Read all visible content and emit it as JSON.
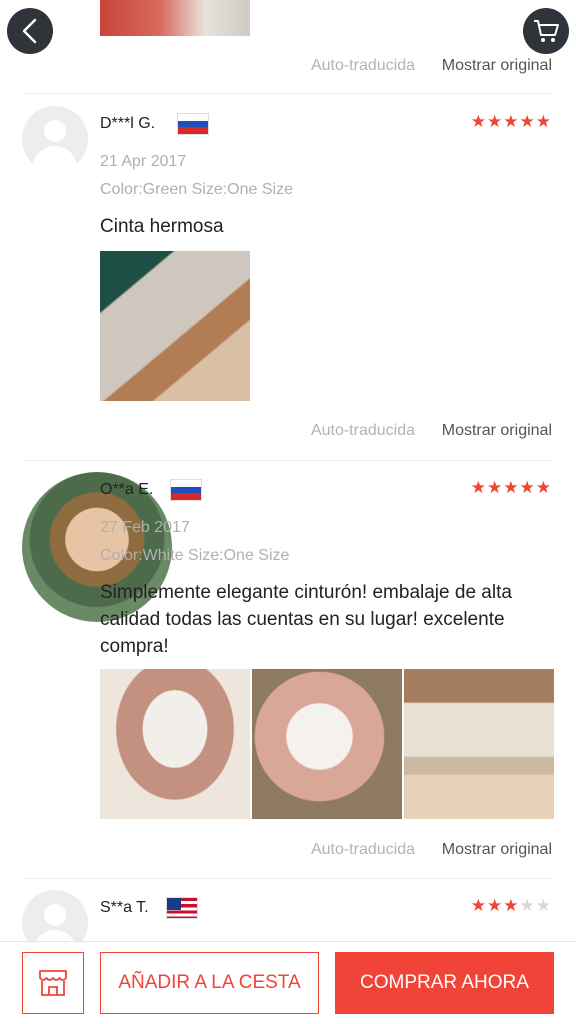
{
  "nav": {
    "back_icon": "chevron-left-icon",
    "cart_icon": "cart-icon"
  },
  "translate": {
    "auto_label": "Auto-traducida",
    "show_original": "Mostrar original"
  },
  "reviews": [
    {
      "name": "D***l G.",
      "country_flag": "russia-flag",
      "rating": 5,
      "stars": "★★★★★",
      "date": "21 Apr 2017",
      "variant": "Color:Green Size:One Size",
      "text": "Cinta hermosa"
    },
    {
      "name": "O**a E.",
      "country_flag": "russia-flag",
      "rating": 5,
      "stars": "★★★★★",
      "date": "27 Feb 2017",
      "variant": "Color:White Size:One Size",
      "text": "Simplemente elegante cinturón! embalaje de alta calidad todas las cuentas en su lugar! excelente compra!"
    },
    {
      "name": "S**a T.",
      "country_flag": "usa-flag",
      "rating": 3,
      "stars_on": "★★★",
      "stars_off": "★★"
    }
  ],
  "bottom_bar": {
    "store_icon": "store-icon",
    "add_to_cart": "AÑADIR A LA CESTA",
    "buy_now": "COMPRAR AHORA"
  },
  "colors": {
    "accent": "#f04438",
    "muted": "#b0b0b0"
  }
}
